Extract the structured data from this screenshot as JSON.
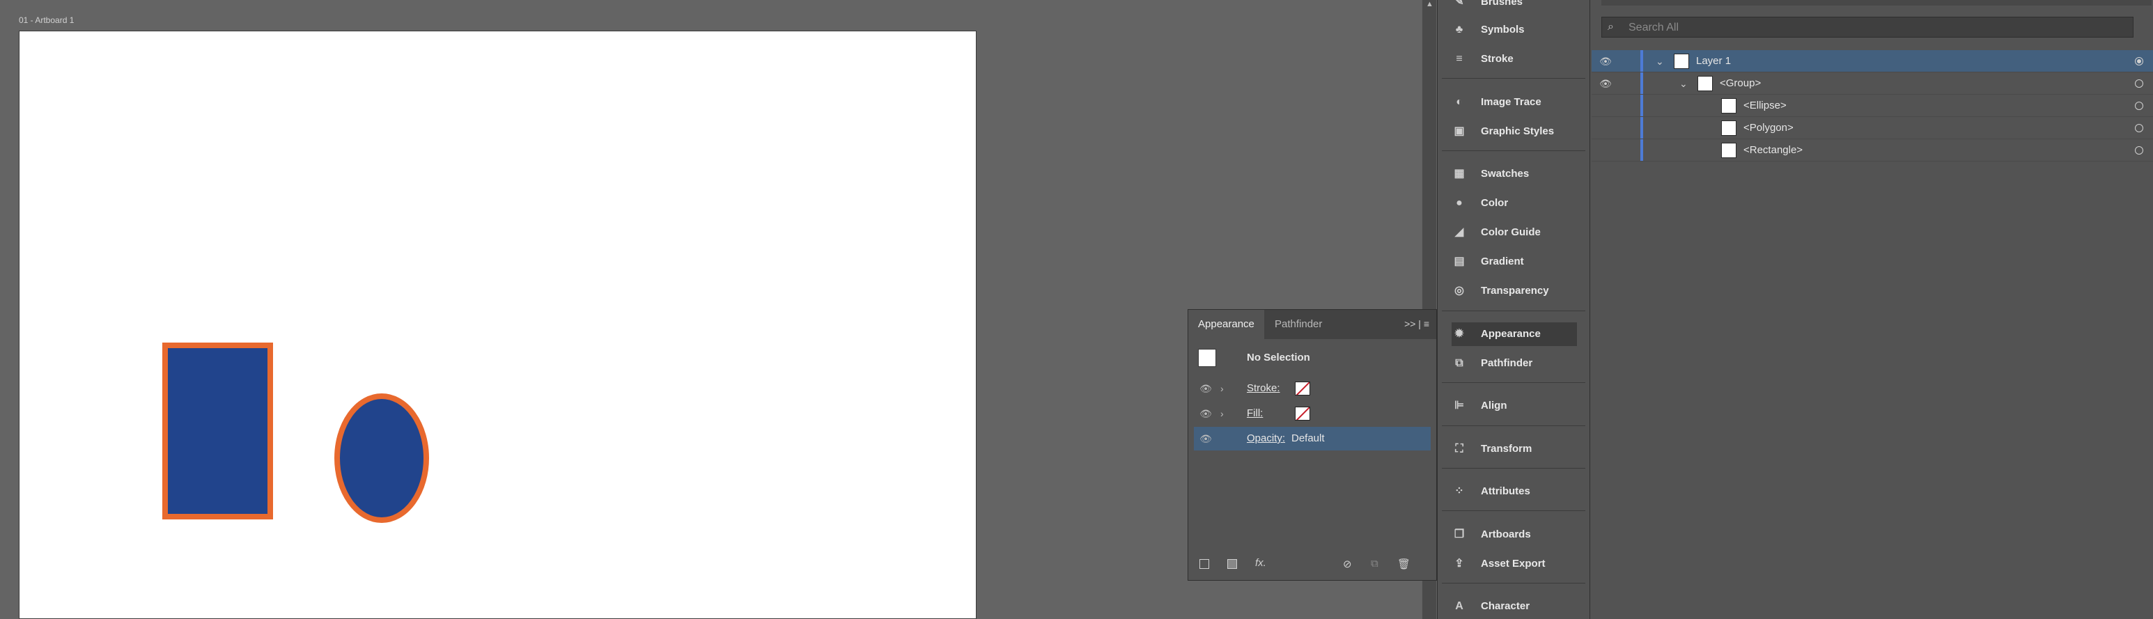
{
  "canvas": {
    "artboard_label": "01 - Artboard 1",
    "colors": {
      "shape_fill": "#21448c",
      "shape_stroke": "#e8692e",
      "artboard": "#ffffff"
    }
  },
  "appearance_panel": {
    "tabs": [
      "Appearance",
      "Pathfinder"
    ],
    "menu_icons": ">> | ≡",
    "no_selection": "No Selection",
    "stroke_label": "Stroke:",
    "fill_label": "Fill:",
    "opacity_label": "Opacity:",
    "opacity_value": "Default",
    "footer_icons": [
      "new-art-basic-appearance-icon",
      "clear-appearance-icon",
      "fx-icon",
      "prohibited-icon",
      "duplicate-icon",
      "trash-icon"
    ]
  },
  "dock": {
    "items": [
      {
        "label": "Brushes",
        "icon": "brush-icon"
      },
      {
        "label": "Symbols",
        "icon": "club-icon"
      },
      {
        "label": "Stroke",
        "icon": "lines-icon"
      },
      {
        "label": "Image Trace",
        "icon": "image-trace-icon"
      },
      {
        "label": "Graphic Styles",
        "icon": "graphic-styles-icon"
      },
      {
        "label": "Swatches",
        "icon": "grid-icon"
      },
      {
        "label": "Color",
        "icon": "palette-icon"
      },
      {
        "label": "Color Guide",
        "icon": "triangle-icon"
      },
      {
        "label": "Gradient",
        "icon": "gradient-icon"
      },
      {
        "label": "Transparency",
        "icon": "circles-icon"
      },
      {
        "label": "Appearance",
        "icon": "sun-icon"
      },
      {
        "label": "Pathfinder",
        "icon": "squares-icon"
      },
      {
        "label": "Align",
        "icon": "align-icon"
      },
      {
        "label": "Transform",
        "icon": "transform-icon"
      },
      {
        "label": "Attributes",
        "icon": "dots-icon"
      },
      {
        "label": "Artboards",
        "icon": "artboard-icon"
      },
      {
        "label": "Asset Export",
        "icon": "export-icon"
      },
      {
        "label": "Character",
        "icon": "char-icon"
      }
    ]
  },
  "layers_panel": {
    "search_placeholder": "Search All",
    "rows": [
      {
        "name": "Layer 1"
      },
      {
        "name": "<Group>"
      },
      {
        "name": "<Ellipse>"
      },
      {
        "name": "<Polygon>"
      },
      {
        "name": "<Rectangle>"
      }
    ]
  }
}
